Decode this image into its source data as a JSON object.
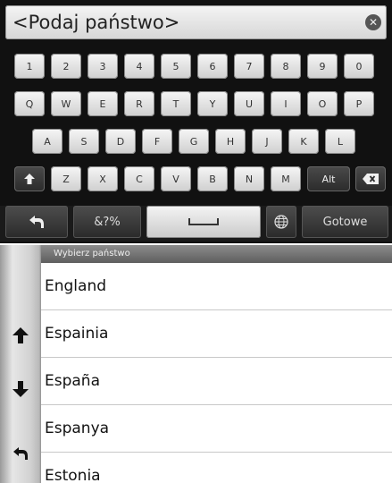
{
  "search": {
    "placeholder": "<Podaj państwo>"
  },
  "keyboard": {
    "numbers": [
      "1",
      "2",
      "3",
      "4",
      "5",
      "6",
      "7",
      "8",
      "9",
      "0"
    ],
    "row1": [
      "Q",
      "W",
      "E",
      "R",
      "T",
      "Y",
      "U",
      "I",
      "O",
      "P"
    ],
    "row2": [
      "A",
      "S",
      "D",
      "F",
      "G",
      "H",
      "J",
      "K",
      "L"
    ],
    "row3": [
      "Z",
      "X",
      "C",
      "V",
      "B",
      "N",
      "M"
    ],
    "alt_label": "Alt",
    "symbols_label": "&?%",
    "done_label": "Gotowe"
  },
  "list": {
    "header": "Wybierz państwo",
    "items": [
      "England",
      "Espainia",
      "España",
      "Espanya",
      "Estonia"
    ]
  },
  "icons": {
    "clear": "clear-icon",
    "shift": "shift-icon",
    "backspace": "backspace-icon",
    "back": "back-icon",
    "space": "space-icon",
    "globe": "globe-icon",
    "scroll_up": "arrow-up-icon",
    "scroll_down": "arrow-down-icon"
  }
}
